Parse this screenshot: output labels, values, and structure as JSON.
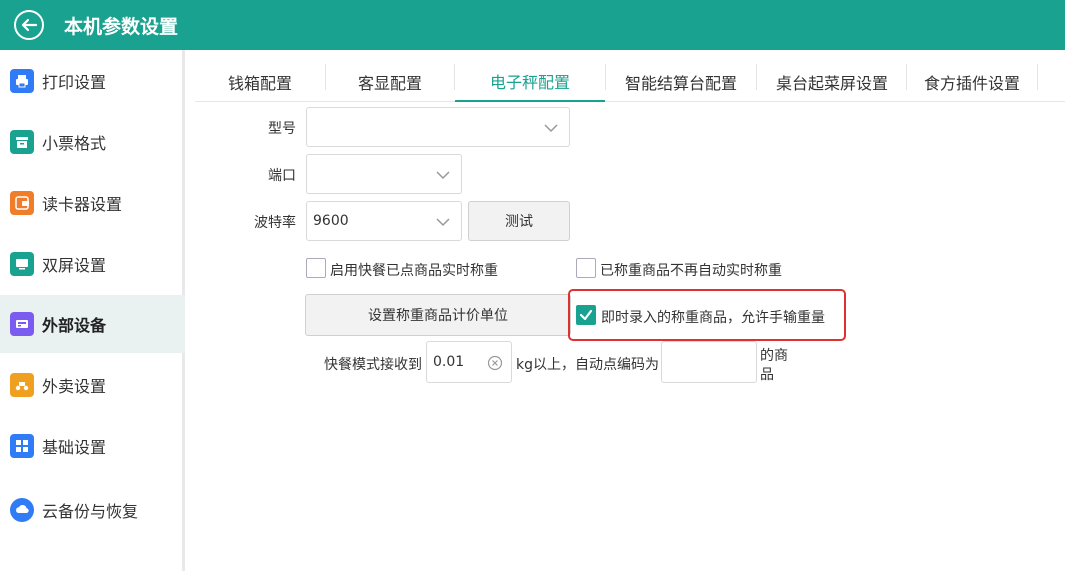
{
  "header": {
    "title": "本机参数设置"
  },
  "sidebar": {
    "items": [
      {
        "label": "打印设置",
        "color": "#2f7cf6"
      },
      {
        "label": "小票格式",
        "color": "#1aa290"
      },
      {
        "label": "读卡器设置",
        "color": "#f07d2a"
      },
      {
        "label": "双屏设置",
        "color": "#1aa290"
      },
      {
        "label": "外部设备",
        "color": "#7b5cf0"
      },
      {
        "label": "外卖设置",
        "color": "#f0a020"
      },
      {
        "label": "基础设置",
        "color": "#2f7cf6"
      },
      {
        "label": "云备份与恢复",
        "color": "#2f7cf6"
      }
    ],
    "active": "外部设备"
  },
  "tabs": [
    {
      "label": "钱箱配置"
    },
    {
      "label": "客显配置"
    },
    {
      "label": "电子秤配置"
    },
    {
      "label": "智能结算台配置"
    },
    {
      "label": "桌台起菜屏设置"
    },
    {
      "label": "食方插件设置"
    }
  ],
  "form": {
    "model": {
      "label": "型号",
      "value": ""
    },
    "port": {
      "label": "端口",
      "value": ""
    },
    "baud": {
      "label": "波特率",
      "value": "9600"
    },
    "test_button": "测试",
    "checkbox_fast_food": {
      "label": "启用快餐已点商品实时称重",
      "checked": false
    },
    "checkbox_no_auto": {
      "label": "已称重商品不再自动实时称重",
      "checked": false
    },
    "unit_button": "设置称重商品计价单位",
    "checkbox_manual": {
      "label": "即时录入的称重商品，允许手输重量",
      "checked": true
    },
    "fast_mode_label": "快餐模式接收到",
    "weight_value": "0.01",
    "after_weight_label": "kg以上，自动点编码为",
    "code_value": "",
    "suffix_label_1": "的商",
    "suffix_label_2": "品"
  },
  "colors": {
    "brand": "#1aa290",
    "highlight": "#e03131"
  }
}
